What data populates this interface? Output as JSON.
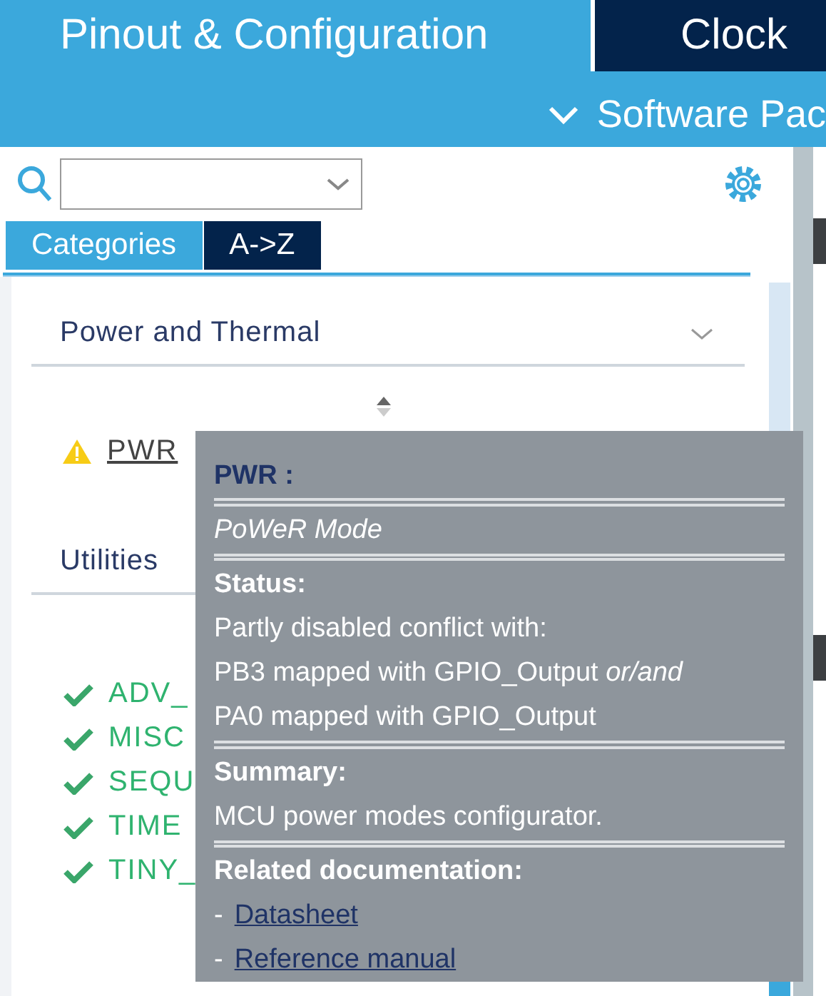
{
  "header": {
    "tabs": [
      {
        "label": "Pinout & Configuration",
        "selected": true
      },
      {
        "label": "Clock",
        "selected": false
      }
    ],
    "software_packs": "Software Pac"
  },
  "view_tabs": [
    {
      "label": "Categories",
      "selected": true
    },
    {
      "label": "A->Z",
      "selected": false
    }
  ],
  "categories": [
    {
      "title": "Power and Thermal",
      "items": [
        {
          "label": "PWR",
          "kind": "warning"
        }
      ]
    },
    {
      "title": "Utilities",
      "items": [
        {
          "label": "ADV_",
          "kind": "ok"
        },
        {
          "label": "MISC",
          "kind": "ok"
        },
        {
          "label": "SEQU",
          "kind": "ok"
        },
        {
          "label": "TIME",
          "kind": "ok"
        },
        {
          "label": "TINY_",
          "kind": "ok"
        }
      ]
    }
  ],
  "tooltip": {
    "title": "PWR :",
    "subtitle": "PoWeR Mode",
    "status_heading": "Status:",
    "status_lines": [
      "Partly disabled conflict with:",
      "PB3 mapped with GPIO_Output *or/and*",
      "PA0 mapped with GPIO_Output"
    ],
    "summary_heading": "Summary:",
    "summary": "MCU power modes configurator.",
    "docs_heading": "Related documentation:",
    "docs": [
      {
        "bullet": "-",
        "label": "Datasheet"
      },
      {
        "bullet": "-",
        "label": "Reference manual"
      }
    ]
  }
}
